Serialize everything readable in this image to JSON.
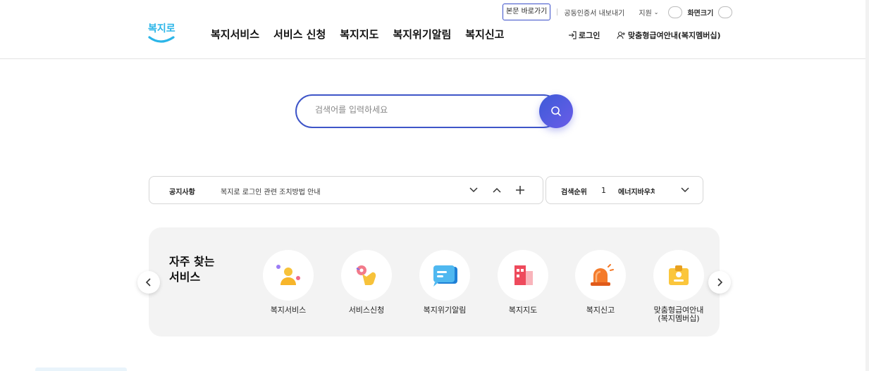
{
  "utility": {
    "skip_link": "본문 바로가기",
    "cert": "공동인증서 내보내기",
    "lang": "지원",
    "zoom": "화면크기"
  },
  "header": {
    "logo_text": "복지로",
    "nav": [
      "복지서비스",
      "서비스 신청",
      "복지지도",
      "복지위기알림",
      "복지신고"
    ],
    "login": "로그인",
    "member": "맞춤형급여안내(복지멤버십)"
  },
  "search": {
    "placeholder": "검색어를 입력하세요"
  },
  "notice": {
    "label": "공지사항",
    "text": "복지로 로그인 관련 조치방법 안내"
  },
  "ranking": {
    "label": "검색순위",
    "rank": "1",
    "keyword": "에너지바우처"
  },
  "frequent": {
    "title_line1": "자주 찾는",
    "title_line2": "서비스",
    "items": [
      {
        "label": "복지서비스",
        "icon": "person-icon"
      },
      {
        "label": "서비스신청",
        "icon": "hand-click-icon"
      },
      {
        "label": "복지위기알림",
        "icon": "chat-icon"
      },
      {
        "label": "복지지도",
        "icon": "building-icon"
      },
      {
        "label": "복지신고",
        "icon": "siren-icon"
      },
      {
        "label": "맞춤형급여안내",
        "label2": "(복지멤버십)",
        "icon": "id-card-icon"
      }
    ]
  },
  "colors": {
    "accent": "#3e55c8",
    "search_button": "#5a5ce0",
    "logo": "#2bb5e8"
  }
}
